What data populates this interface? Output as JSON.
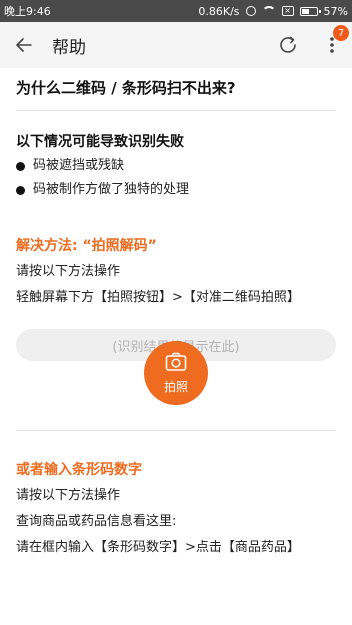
{
  "status_bar": {
    "time": "晚上9:46",
    "net_speed": "0.86K/s",
    "battery": "57%",
    "battery_level": 0.57,
    "icons": [
      "alarm-icon",
      "wifi-icon",
      "sim-x-icon",
      "battery-icon"
    ]
  },
  "app_bar": {
    "title": "帮助",
    "badge": "7",
    "icons": [
      "back-arrow-icon",
      "refresh-icon",
      "more-vert-icon"
    ]
  },
  "content": {
    "question": "为什么二维码 / 条形码扫不出来?",
    "reasons_title": "以下情况可能导致识别失败",
    "reasons": [
      "码被遮挡或残缺",
      "码被制作方做了独特的处理"
    ],
    "solution_title": "解决方法: “拍照解码”",
    "solution_p1": "请按以下方法操作",
    "solution_p2": "轻触屏幕下方【拍照按钮】>【对准二维码拍照】",
    "result_placeholder": "(识别结果将显示在此)",
    "photo_button_label": "拍照",
    "alt_title": "或者输入条形码数字",
    "alt_p1": "请按以下方法操作",
    "alt_p2": "查询商品或药品信息看这里:",
    "alt_p3": "请在框内输入【条形码数字】>点击【商品药品】"
  },
  "colors": {
    "accent": "#ef6b1f",
    "status_bar_bg": "#4a4a4a",
    "app_bar_bg": "#f5f5f5"
  }
}
